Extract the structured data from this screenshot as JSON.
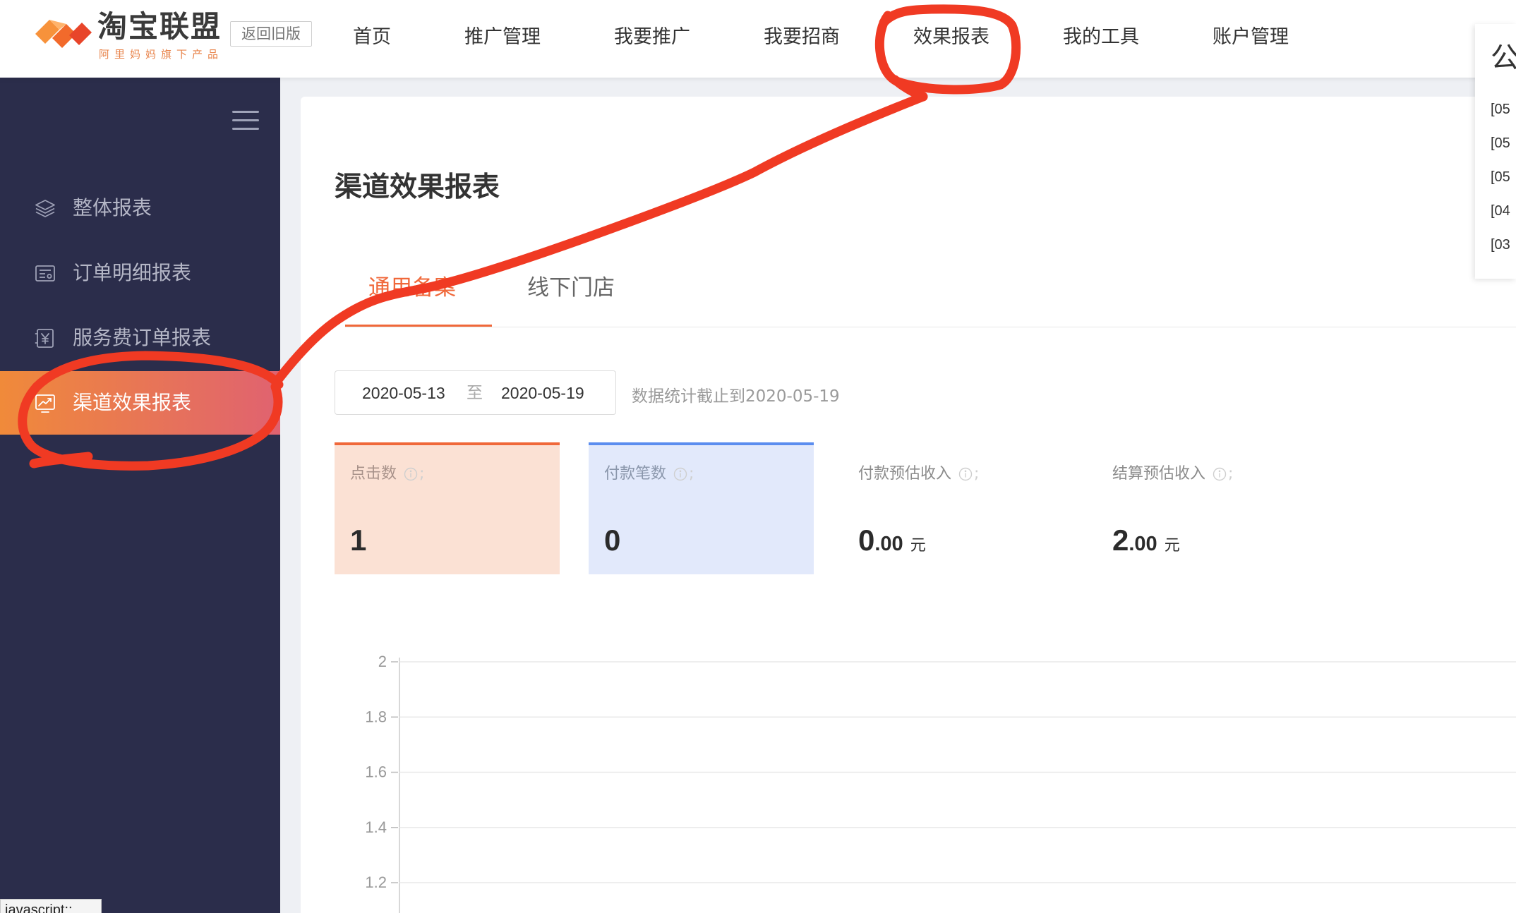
{
  "header": {
    "logo": {
      "title": "淘宝联盟",
      "subtitle": "阿里妈妈旗下产品"
    },
    "old_version_label": "返回旧版",
    "nav": [
      {
        "label": "首页"
      },
      {
        "label": "推广管理"
      },
      {
        "label": "我要推广"
      },
      {
        "label": "我要招商"
      },
      {
        "label": "效果报表",
        "active": true
      },
      {
        "label": "我的工具"
      },
      {
        "label": "账户管理"
      }
    ]
  },
  "announcement": {
    "title": "公",
    "items": [
      "[05",
      "[05",
      "[05",
      "[04",
      "[03"
    ]
  },
  "sidebar": {
    "toggle_icon": "hamburger-menu-icon",
    "items": [
      {
        "label": "整体报表",
        "icon": "layers-icon"
      },
      {
        "label": "订单明细报表",
        "icon": "order-detail-icon"
      },
      {
        "label": "服务费订单报表",
        "icon": "yen-receipt-icon"
      },
      {
        "label": "渠道效果报表",
        "icon": "trend-chart-icon",
        "active": true
      }
    ]
  },
  "main": {
    "title": "渠道效果报表",
    "tabs": [
      {
        "label": "通用备案",
        "active": true
      },
      {
        "label": "线下门店"
      }
    ],
    "date_range": {
      "start": "2020-05-13",
      "separator": "至",
      "end": "2020-05-19"
    },
    "data_note": "数据统计截止到2020-05-19",
    "stats": [
      {
        "label": "点击数",
        "icon": "info-icon",
        "suffix": ";",
        "value_int": "1"
      },
      {
        "label": "付款笔数",
        "icon": "info-icon",
        "suffix": ";",
        "value_int": "0"
      },
      {
        "label": "付款预估收入",
        "icon": "info-icon",
        "suffix": ";",
        "value_int": "0",
        "value_dec": ".00",
        "unit": "元"
      },
      {
        "label": "结算预估收入",
        "icon": "info-icon",
        "suffix": ";",
        "value_int": "2",
        "value_dec": ".00",
        "unit": "元"
      }
    ],
    "chart": {
      "y_ticks": [
        2,
        1.8,
        1.6,
        1.4,
        1.2
      ]
    }
  },
  "status_bar": {
    "text": "javascript:;"
  },
  "colors": {
    "brand_orange": "#f0683a",
    "sidebar_bg": "#2b2d4b",
    "clicks_card_bg": "#fbe1d4",
    "payments_card_bg": "#e2e9fb",
    "payments_accent": "#5b8def",
    "annotation_red": "#f03a23"
  }
}
